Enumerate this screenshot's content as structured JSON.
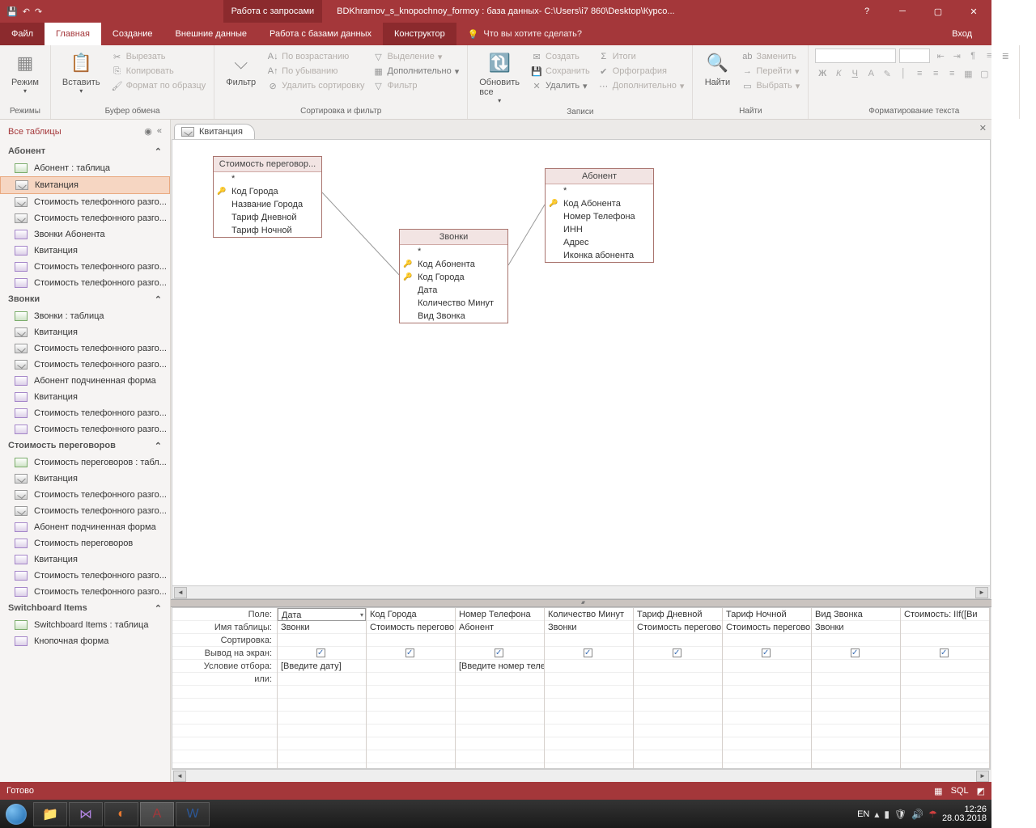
{
  "titlebar": {
    "context": "Работа с запросами",
    "file_title": "BDKhramov_s_knopochnoy_formoy : база данных- C:\\Users\\i7 860\\Desktop\\Курсо..."
  },
  "tabs": {
    "file": "Файл",
    "home": "Главная",
    "create": "Создание",
    "external": "Внешние данные",
    "dbtools": "Работа с базами данных",
    "constructor": "Конструктор",
    "tell_me": "Что вы хотите сделать?",
    "login": "Вход"
  },
  "ribbon": {
    "mode": "Режим",
    "modes_label": "Режимы",
    "paste": "Вставить",
    "cut": "Вырезать",
    "copy": "Копировать",
    "fmt_painter": "Формат по образцу",
    "clipboard_label": "Буфер обмена",
    "filter": "Фильтр",
    "sort_asc": "По возрастанию",
    "sort_desc": "По убыванию",
    "sort_clear": "Удалить сортировку",
    "selection": "Выделение",
    "advanced": "Дополнительно",
    "filter_toggle": "Фильтр",
    "sortfilter_label": "Сортировка и фильтр",
    "refresh": "Обновить все",
    "new": "Создать",
    "save": "Сохранить",
    "delete": "Удалить",
    "totals": "Итоги",
    "spell": "Орфография",
    "more": "Дополнительно",
    "records_label": "Записи",
    "find": "Найти",
    "replace": "Заменить",
    "goto": "Перейти",
    "select": "Выбрать",
    "find_label": "Найти",
    "fmt_label": "Форматирование текста"
  },
  "navpane": {
    "header": "Все таблицы",
    "groups": [
      {
        "title": "Абонент",
        "items": [
          {
            "t": "tbl",
            "label": "Абонент : таблица"
          },
          {
            "t": "qry",
            "label": "Квитанция",
            "sel": true
          },
          {
            "t": "qry",
            "label": "Стоимость телефонного разго..."
          },
          {
            "t": "qry",
            "label": "Стоимость телефонного разго..."
          },
          {
            "t": "frm",
            "label": "Звонки Абонента"
          },
          {
            "t": "frm",
            "label": "Квитанция"
          },
          {
            "t": "frm",
            "label": "Стоимость телефонного разго..."
          },
          {
            "t": "frm",
            "label": "Стоимость телефонного разго..."
          }
        ]
      },
      {
        "title": "Звонки",
        "items": [
          {
            "t": "tbl",
            "label": "Звонки : таблица"
          },
          {
            "t": "qry",
            "label": "Квитанция"
          },
          {
            "t": "qry",
            "label": "Стоимость телефонного разго..."
          },
          {
            "t": "qry",
            "label": "Стоимость телефонного разго..."
          },
          {
            "t": "frm",
            "label": "Абонент подчиненная форма"
          },
          {
            "t": "frm",
            "label": "Квитанция"
          },
          {
            "t": "frm",
            "label": "Стоимость телефонного разго..."
          },
          {
            "t": "frm",
            "label": "Стоимость телефонного разго..."
          }
        ]
      },
      {
        "title": "Стоимость переговоров",
        "items": [
          {
            "t": "tbl",
            "label": "Стоимость переговоров : табл..."
          },
          {
            "t": "qry",
            "label": "Квитанция"
          },
          {
            "t": "qry",
            "label": "Стоимость телефонного разго..."
          },
          {
            "t": "qry",
            "label": "Стоимость телефонного разго..."
          },
          {
            "t": "frm",
            "label": "Абонент подчиненная форма"
          },
          {
            "t": "frm",
            "label": "Стоимость переговоров"
          },
          {
            "t": "frm",
            "label": "Квитанция"
          },
          {
            "t": "frm",
            "label": "Стоимость телефонного разго..."
          },
          {
            "t": "frm",
            "label": "Стоимость телефонного разго..."
          }
        ]
      },
      {
        "title": "Switchboard Items",
        "items": [
          {
            "t": "tbl",
            "label": "Switchboard Items : таблица"
          },
          {
            "t": "frm",
            "label": "Кнопочная форма"
          }
        ]
      }
    ]
  },
  "doctab": "Квитанция",
  "tables": {
    "t1": {
      "title": "Стоимость переговор...",
      "rows": [
        {
          "k": false,
          "l": "*"
        },
        {
          "k": true,
          "l": "Код Города"
        },
        {
          "k": false,
          "l": "Название Города"
        },
        {
          "k": false,
          "l": "Тариф Дневной"
        },
        {
          "k": false,
          "l": "Тариф Ночной"
        }
      ]
    },
    "t2": {
      "title": "Звонки",
      "rows": [
        {
          "k": false,
          "l": "*"
        },
        {
          "k": true,
          "l": "Код Абонента"
        },
        {
          "k": true,
          "l": "Код Города"
        },
        {
          "k": false,
          "l": "Дата"
        },
        {
          "k": false,
          "l": "Количество Минут"
        },
        {
          "k": false,
          "l": "Вид Звонка"
        }
      ]
    },
    "t3": {
      "title": "Абонент",
      "rows": [
        {
          "k": false,
          "l": "*"
        },
        {
          "k": true,
          "l": "Код Абонента"
        },
        {
          "k": false,
          "l": "Номер Телефона"
        },
        {
          "k": false,
          "l": "ИНН"
        },
        {
          "k": false,
          "l": "Адрес"
        },
        {
          "k": false,
          "l": "Иконка абонента"
        }
      ]
    }
  },
  "grid": {
    "rowlabels": [
      "Поле:",
      "Имя таблицы:",
      "Сортировка:",
      "Вывод на экран:",
      "Условие отбора:",
      "или:"
    ],
    "cols": [
      {
        "field": "Дата",
        "table": "Звонки",
        "show": true,
        "crit": "[Введите дату]"
      },
      {
        "field": "Код Города",
        "table": "Стоимость перегово",
        "show": true,
        "crit": ""
      },
      {
        "field": "Номер Телефона",
        "table": "Абонент",
        "show": true,
        "crit": "[Введите номер теле"
      },
      {
        "field": "Количество Минут",
        "table": "Звонки",
        "show": true,
        "crit": ""
      },
      {
        "field": "Тариф Дневной",
        "table": "Стоимость перегово",
        "show": true,
        "crit": ""
      },
      {
        "field": "Тариф Ночной",
        "table": "Стоимость перегово",
        "show": true,
        "crit": ""
      },
      {
        "field": "Вид Звонка",
        "table": "Звонки",
        "show": true,
        "crit": ""
      },
      {
        "field": "Стоимость: IIf([Ви",
        "table": "",
        "show": true,
        "crit": ""
      }
    ]
  },
  "status": {
    "ready": "Готово",
    "sql": "SQL"
  },
  "tray": {
    "lang": "EN",
    "time": "12:26",
    "date": "28.03.2018"
  }
}
